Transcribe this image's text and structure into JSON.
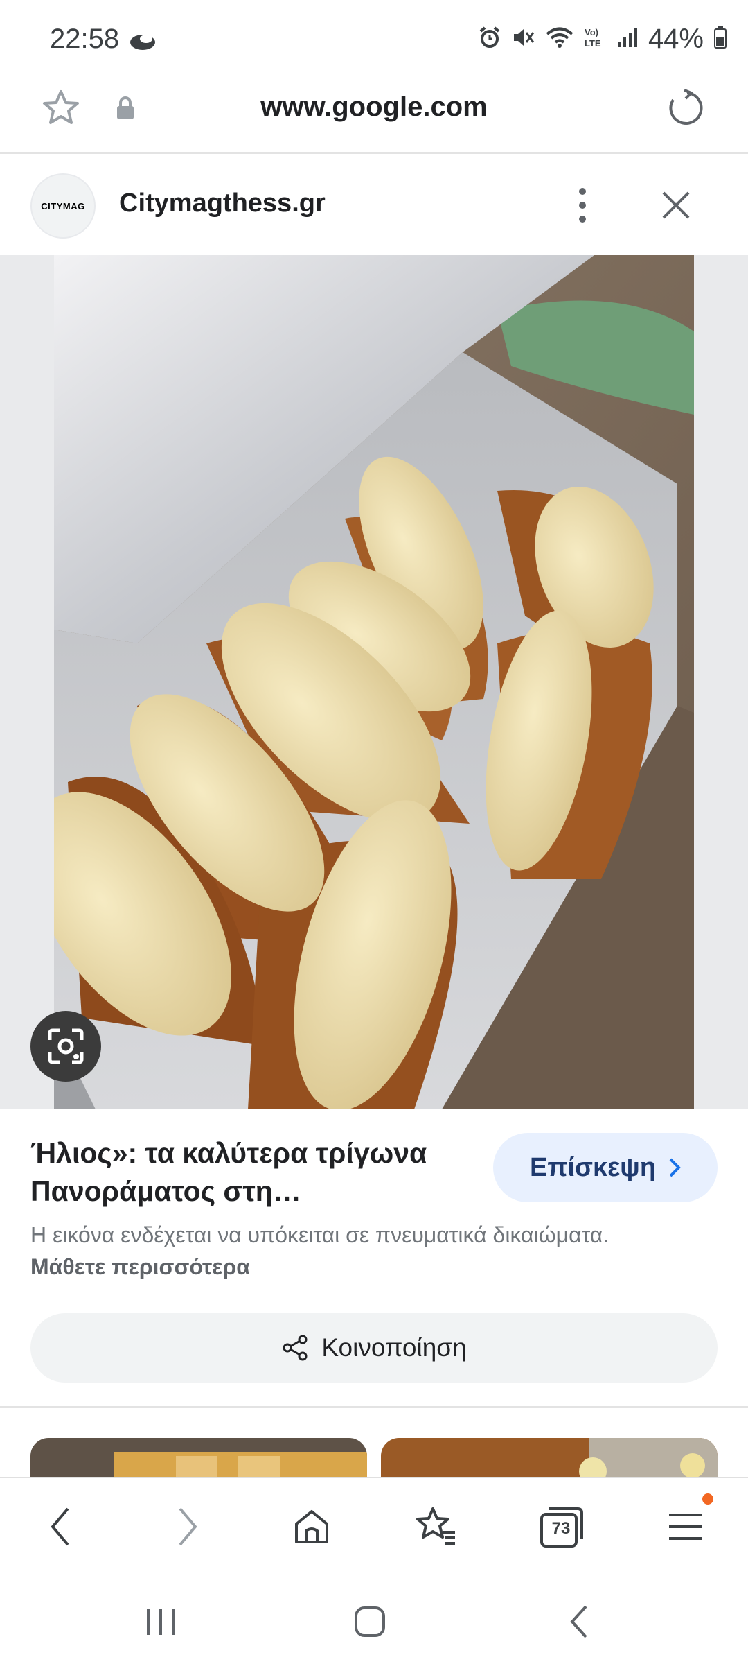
{
  "status_bar": {
    "time": "22:58",
    "battery": "44%",
    "icons": [
      "cloud-icon",
      "alarm-icon",
      "mute-icon",
      "wifi-icon",
      "volte-icon",
      "signal-icon",
      "battery-icon"
    ],
    "volte_label": "Vo) LTE"
  },
  "address_bar": {
    "url": "www.google.com"
  },
  "source": {
    "logo_text": "CITYMAG",
    "name": "Citymagthess.gr"
  },
  "result": {
    "title": "Ήλιος»: τα καλύτερα τρίγωνα Πανοράματος στη…",
    "visit_label": "Επίσκεψη",
    "copyright_text": "Η εικόνα ενδέχεται να υπόκειται σε πνευματικά δικαιώματα.",
    "learn_more": "Μάθετε περισσότερα",
    "share_label": "Κοινοποίηση"
  },
  "browser_nav": {
    "tabs_count": "73"
  },
  "colors": {
    "accent_pill": "#e8f0fe",
    "accent_text": "#1f3a6e",
    "notification_dot": "#f26722"
  }
}
